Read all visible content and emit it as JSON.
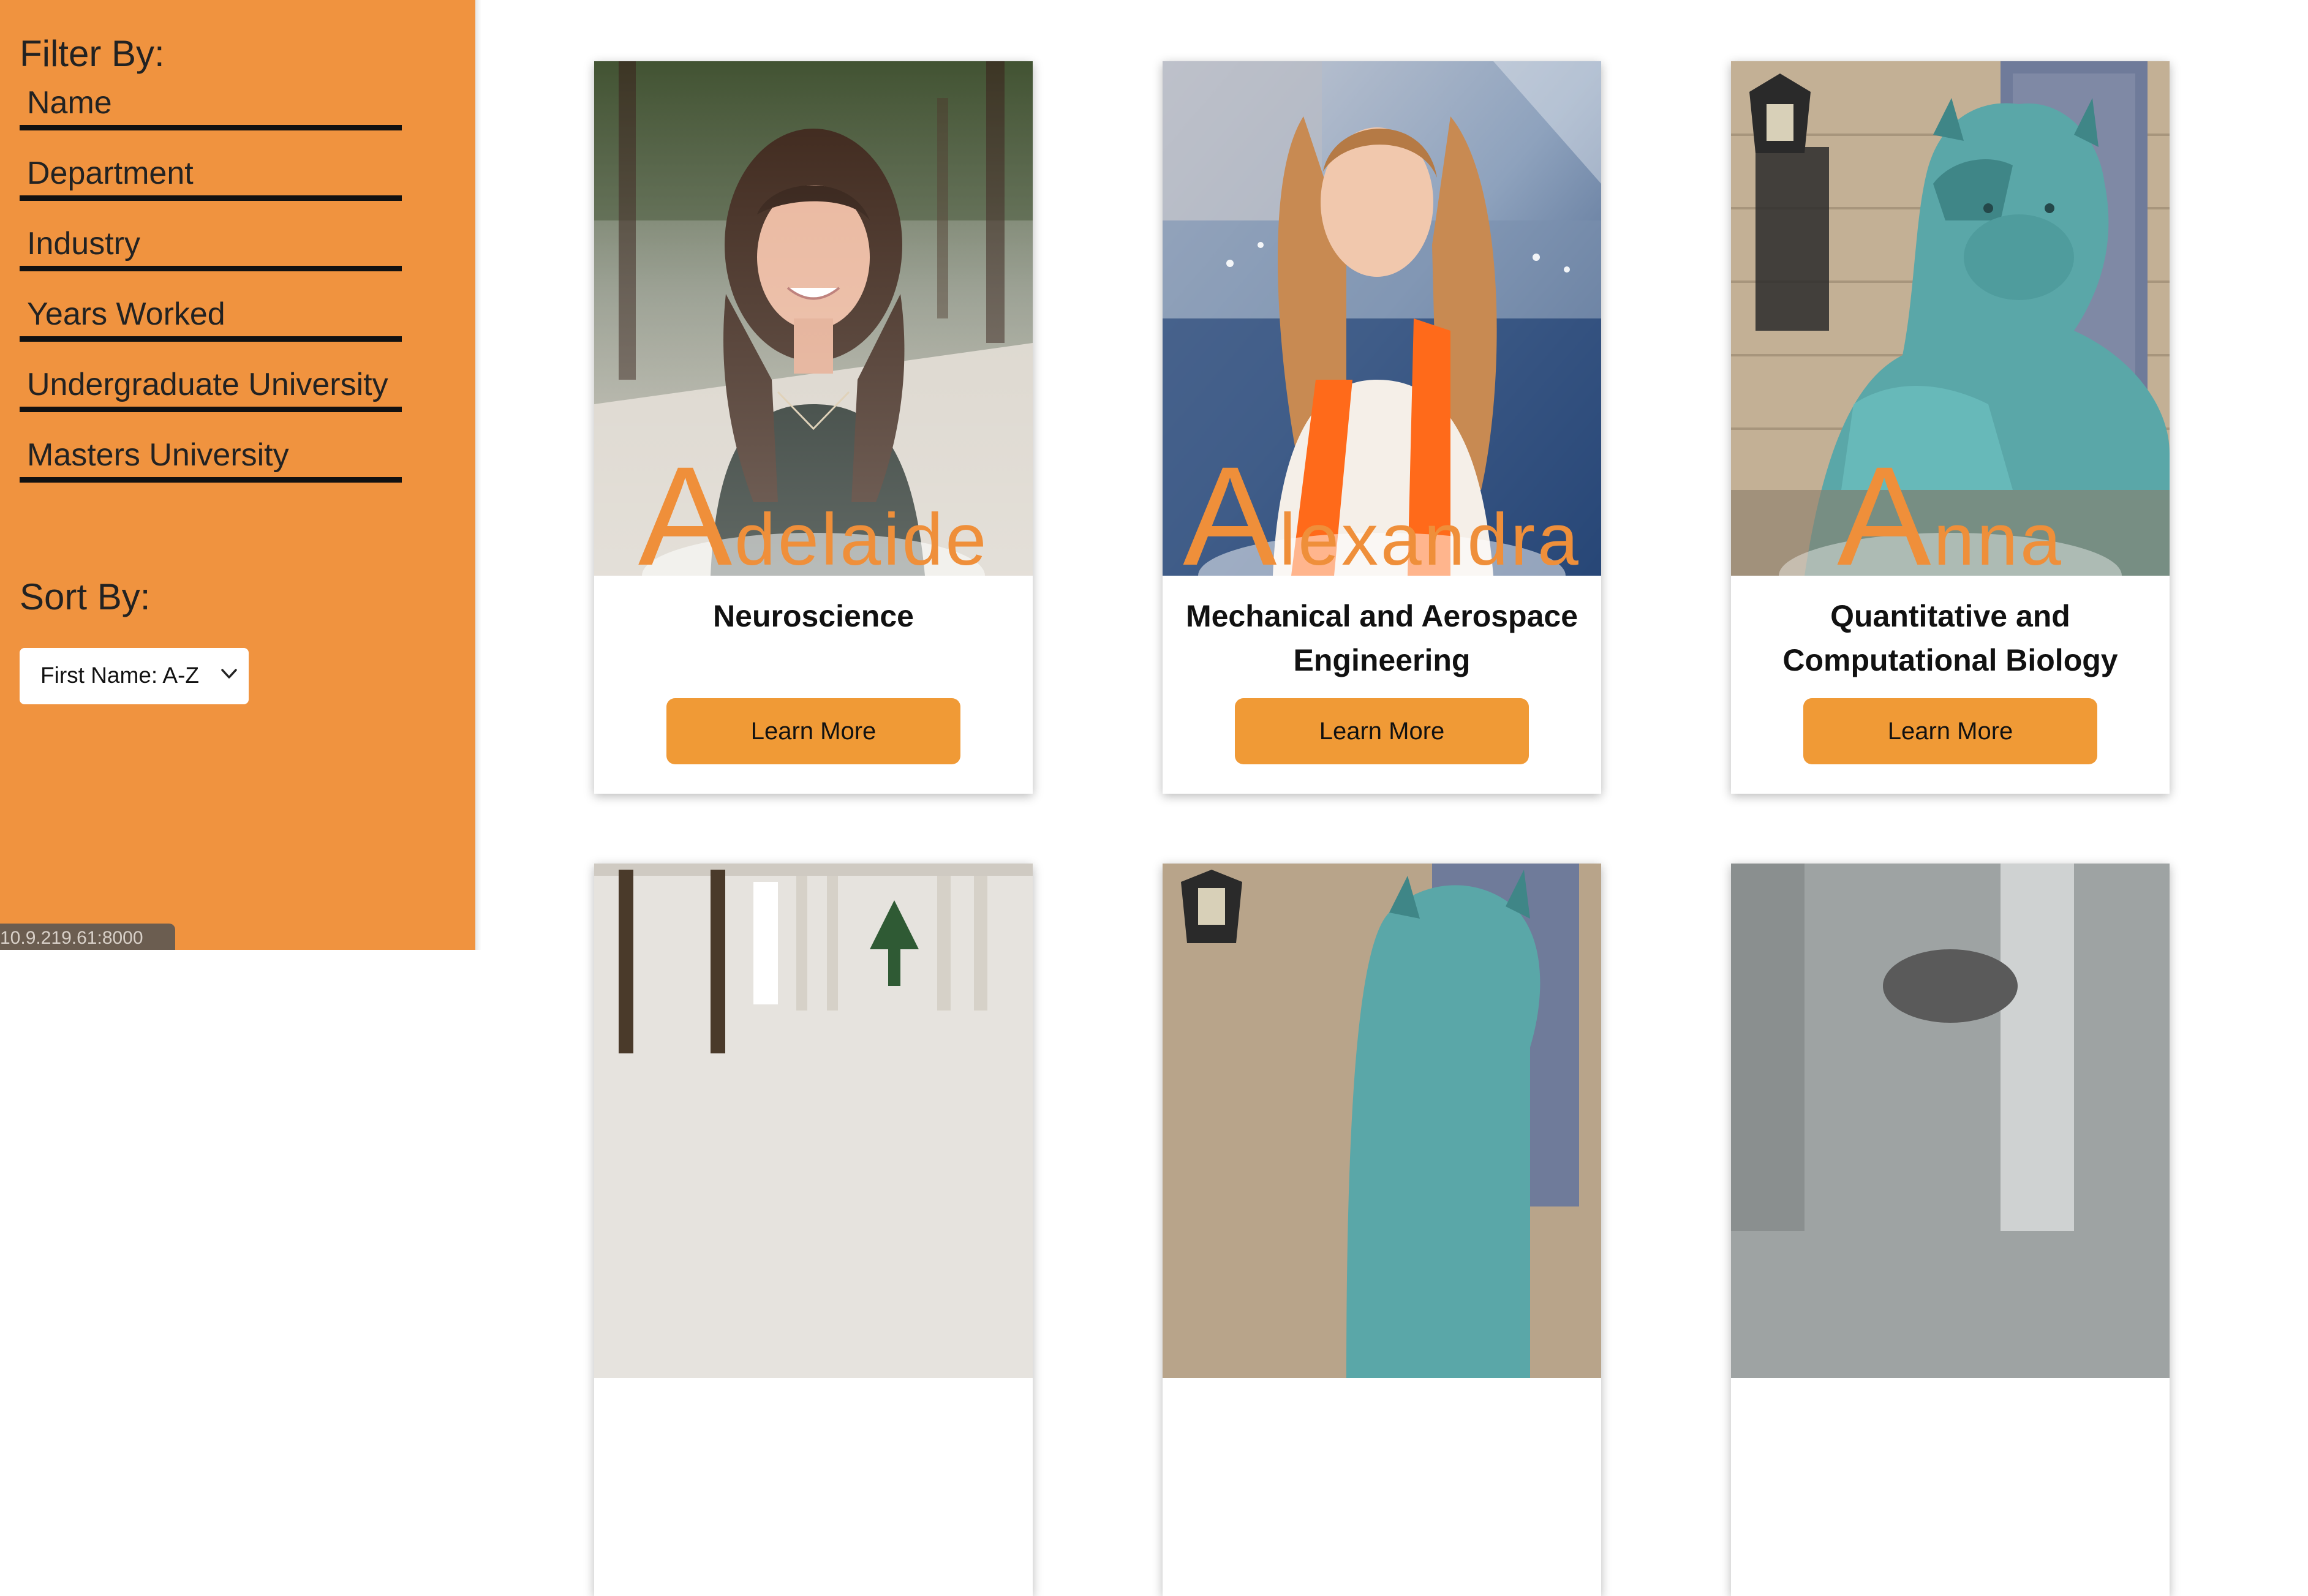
{
  "sidebar": {
    "filter_heading": "Filter By:",
    "filters": [
      {
        "label": "Name"
      },
      {
        "label": "Department"
      },
      {
        "label": "Industry"
      },
      {
        "label": "Years Worked"
      },
      {
        "label": "Undergraduate University"
      },
      {
        "label": "Masters University"
      }
    ],
    "sort_heading": "Sort By:",
    "sort_selected": "First Name: A-Z"
  },
  "status_url": "10.9.219.61:8000",
  "cards": [
    {
      "name_initial": "A",
      "name_rest": "delaide",
      "department": "Neuroscience",
      "button": "Learn More",
      "photo_icon": "portrait-woman-photo"
    },
    {
      "name_initial": "A",
      "name_rest": "lexandra",
      "department": "Mechanical and Aerospace Engineering",
      "button": "Learn More",
      "photo_icon": "portrait-graduate-photo"
    },
    {
      "name_initial": "A",
      "name_rest": "nna",
      "department": "Quantitative and Computational Biology",
      "button": "Learn More",
      "photo_icon": "tiger-statue-photo"
    },
    {
      "photo_icon": "campus-building-photo"
    },
    {
      "photo_icon": "tiger-statue-photo"
    },
    {
      "photo_icon": "portrait-photo"
    }
  ],
  "colors": {
    "sidebar_bg": "#f0933f",
    "accent": "#ef8f3a",
    "button_bg": "#f09a36"
  }
}
